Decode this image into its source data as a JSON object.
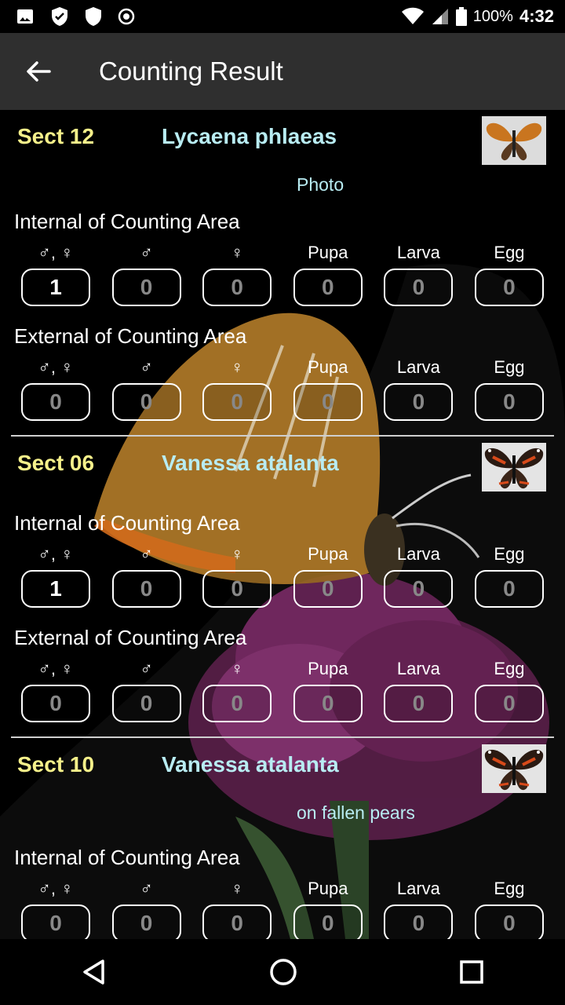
{
  "status": {
    "battery": "100%",
    "time": "4:32"
  },
  "appbar": {
    "title": "Counting Result"
  },
  "columns": [
    "♂, ♀",
    "♂",
    "♀",
    "Pupa",
    "Larva",
    "Egg"
  ],
  "records": [
    {
      "sect": "Sect 12",
      "species": "Lycaena phlaeas",
      "note": "Photo",
      "internal_label": "Internal of Counting Area",
      "internal": [
        "1",
        "0",
        "0",
        "0",
        "0",
        "0"
      ],
      "external_label": "External of Counting Area",
      "external": [
        "0",
        "0",
        "0",
        "0",
        "0",
        "0"
      ]
    },
    {
      "sect": "Sect 06",
      "species": "Vanessa atalanta",
      "note": "",
      "internal_label": "Internal of Counting Area",
      "internal": [
        "1",
        "0",
        "0",
        "0",
        "0",
        "0"
      ],
      "external_label": "External of Counting Area",
      "external": [
        "0",
        "0",
        "0",
        "0",
        "0",
        "0"
      ]
    },
    {
      "sect": "Sect 10",
      "species": "Vanessa atalanta",
      "note": "on fallen pears",
      "internal_label": "Internal of Counting Area",
      "internal": [
        "0",
        "0",
        "0",
        "0",
        "0",
        "0"
      ]
    }
  ]
}
